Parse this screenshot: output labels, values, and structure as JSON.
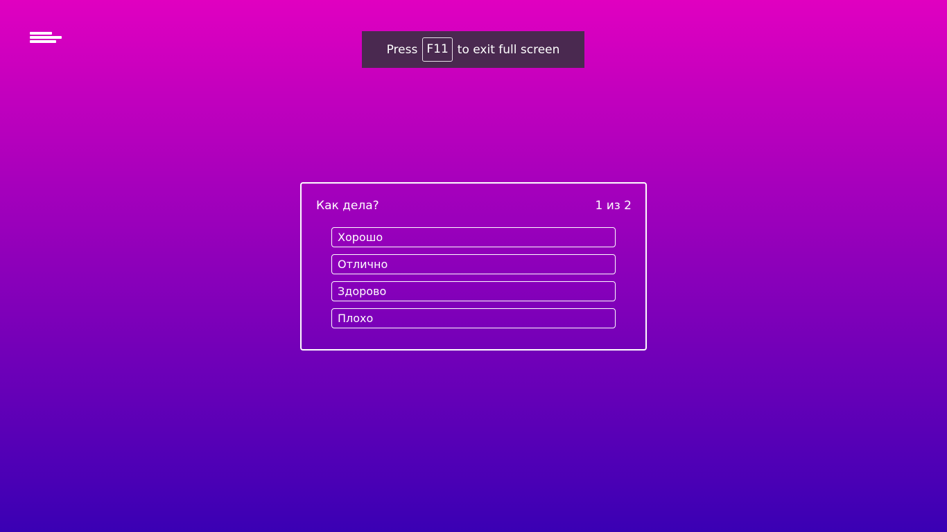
{
  "theme": {
    "gradient_top": "#e000c0",
    "gradient_bottom": "#3a00b4",
    "toast_background": "#4a2950",
    "foreground": "#ffffff"
  },
  "menu": {
    "icon": "hamburger-menu-icon"
  },
  "fullscreen_notice": {
    "prefix": "Press",
    "key": "F11",
    "suffix": "to exit full screen"
  },
  "quiz": {
    "question": "Как дела?",
    "progress": "1 из 2",
    "options": [
      {
        "label": "Хорошо"
      },
      {
        "label": "Отлично"
      },
      {
        "label": "Здорово"
      },
      {
        "label": "Плохо"
      }
    ]
  }
}
